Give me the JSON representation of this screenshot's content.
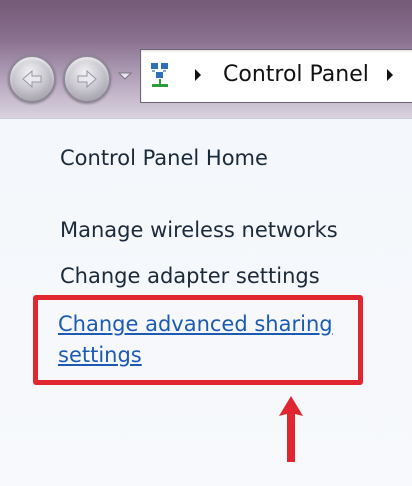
{
  "navigation": {
    "back_icon": "back-arrow-icon",
    "forward_icon": "forward-arrow-icon",
    "recent_icon": "chevron-down-icon"
  },
  "address_bar": {
    "icon": "network-icon",
    "segment": "Control Panel"
  },
  "left_pane": {
    "home_link": "Control Panel Home",
    "links": [
      "Manage wireless networks",
      "Change adapter settings",
      "Change advanced sharing settings"
    ]
  },
  "annotation": {
    "highlight_color": "#e0262f",
    "arrow_color": "#e0262f"
  }
}
